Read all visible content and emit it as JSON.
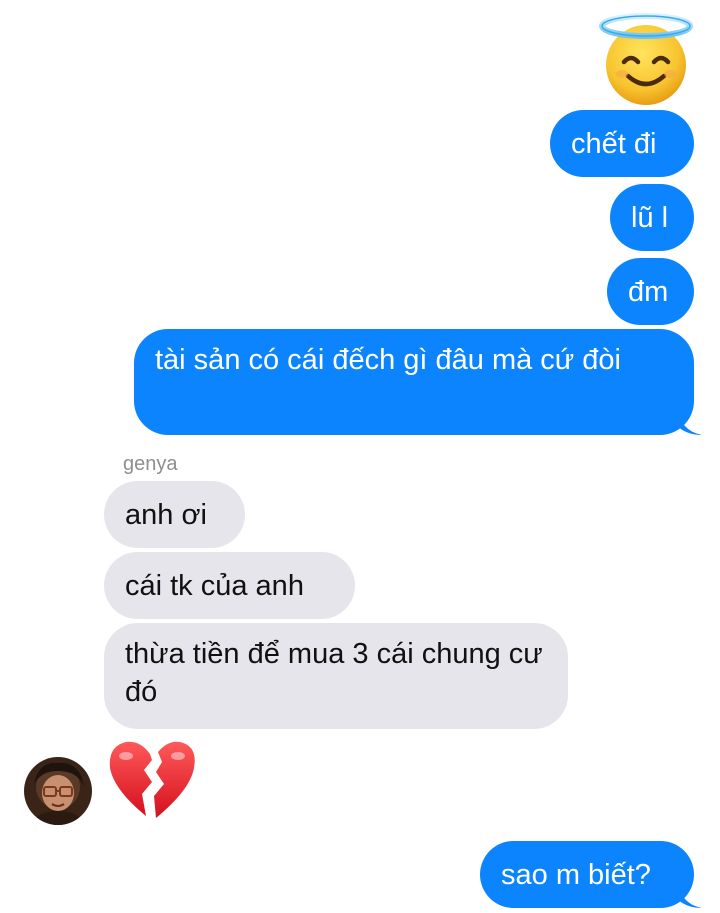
{
  "thread": {
    "sender_name": "genya",
    "outgoing_messages": [
      {
        "text": "chết đi"
      },
      {
        "text": "lũ l"
      },
      {
        "text": "đm"
      },
      {
        "text": "tài sản có cái đếch gì đâu mà cứ đòi"
      },
      {
        "text": "sao m biết?"
      }
    ],
    "incoming_messages": [
      {
        "text": "anh ơi"
      },
      {
        "text": "cái tk của anh"
      },
      {
        "text": "thừa tiền để mua 3 cái chung cư đó"
      }
    ],
    "emoji_messages": [
      {
        "icon": "smiling-face-with-halo-icon",
        "direction": "outgoing"
      },
      {
        "icon": "broken-heart-icon",
        "direction": "incoming"
      }
    ]
  },
  "colors": {
    "outgoing_bubble": "#0b84fe",
    "incoming_bubble": "#e6e5eb",
    "sender_label": "#8e8e93"
  }
}
